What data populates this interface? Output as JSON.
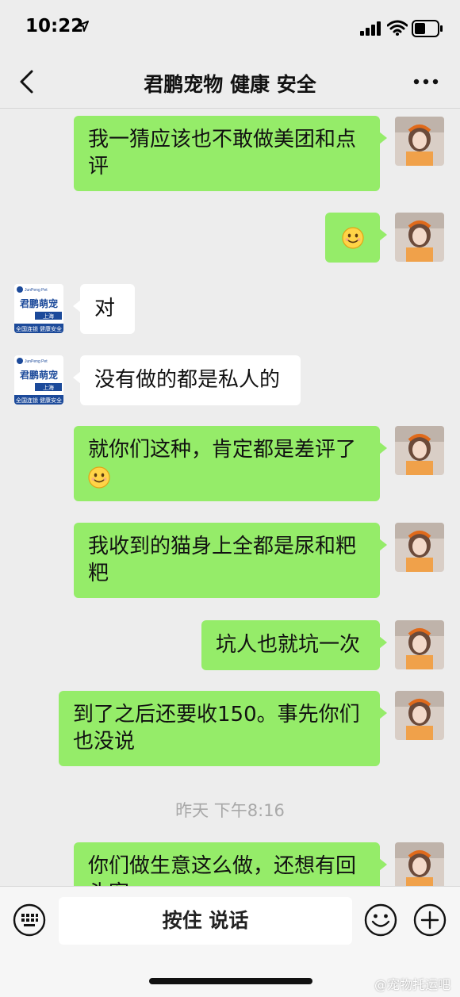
{
  "status_bar": {
    "time": "10:22"
  },
  "header": {
    "title": "君鹏宠物 健康 安全"
  },
  "shop_avatar": {
    "brand": "JunPeng Pet",
    "name": "君鹏萌宠",
    "city": "上海",
    "slogan": "全国连锁 健康安全"
  },
  "messages": [
    {
      "side": "me",
      "lines": [
        "我一猜应该也不敢做美团和点",
        "评"
      ]
    },
    {
      "side": "me",
      "emoji": "smile-emoji"
    },
    {
      "side": "shop",
      "lines": [
        "对"
      ]
    },
    {
      "side": "shop",
      "lines": [
        "没有做的都是私人的"
      ]
    },
    {
      "side": "me",
      "lines": [
        "就你们这种，肯定都是差评了"
      ],
      "trailing_emoji": "smile-emoji"
    },
    {
      "side": "me",
      "lines": [
        "我收到的猫身上全都是尿和粑",
        "粑"
      ]
    },
    {
      "side": "me",
      "lines": [
        "坑人也就坑一次"
      ]
    },
    {
      "side": "me",
      "lines": [
        "到了之后还要收150。事先你们",
        "也没说"
      ]
    },
    {
      "side": "me",
      "lines": [
        "你们做生意这么做，还想有回",
        "头客"
      ]
    }
  ],
  "timestamp": "昨天 下午8:16",
  "input_bar": {
    "hold_to_talk": "按住 说话"
  },
  "watermark": "@宠物托运吧",
  "colors": {
    "my_bubble": "#95ec69",
    "their_bubble": "#ffffff",
    "background": "#ededed"
  }
}
